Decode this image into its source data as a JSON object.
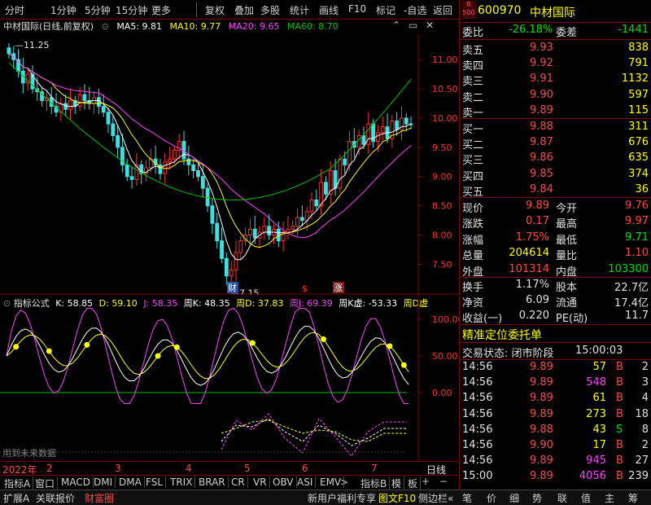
{
  "toolbar": {
    "items": [
      "分时",
      "1分钟",
      "5分钟",
      "15分钟",
      "更多",
      "复权",
      "叠加",
      "多股",
      "统计",
      "画线",
      "F10",
      "标记",
      "-自选",
      "返回"
    ]
  },
  "chart_header": {
    "name": "中材国际(日线,前复权)",
    "ma5": "MA5: 9.81",
    "ma10": "MA10: 9.77",
    "ma20": "MA20: 9.65",
    "ma60": "MA60: 8.70"
  },
  "colors": {
    "ma5": "#ffffff",
    "ma10": "#ffff00",
    "ma20": "#ff40ff",
    "ma60": "#00c000",
    "up": "#ff3030",
    "down": "#40e0e0"
  },
  "price_axis": [
    "11.00",
    "10.50",
    "10.00",
    "9.50",
    "9.00",
    "8.50",
    "8.00",
    "7.50"
  ],
  "annotations": {
    "high": "11.25",
    "low": "7.15",
    "cai": "财",
    "s": "$",
    "zhang": "涨"
  },
  "indicator_header": {
    "title": "指标公式",
    "k": "K: 58.85",
    "d": "D: 59.10",
    "j": "J: 58.35",
    "wk": "周K: 48.35",
    "wd": "周D: 37.83",
    "wj": "周J: 69.39",
    "wkx": "周K虚: -53.33",
    "wdx": "周D虚"
  },
  "indicator_axis": [
    "100.00",
    "50.00",
    "0.00"
  ],
  "future_note": "用到未来数据",
  "date_axis": {
    "year": "2022年",
    "months": [
      "2",
      "3",
      "4",
      "5",
      "6",
      "7"
    ],
    "period": "日线"
  },
  "bottom_tabs": [
    "指标A",
    "窗口",
    "MACD",
    "DMI",
    "DMA",
    "FSL",
    "TRIX",
    "BRAR",
    "CR",
    "VR",
    "OBV",
    "ASI",
    "EMV",
    "指标B",
    "模",
    "板"
  ],
  "status_bar": {
    "items": [
      "扩展A",
      "关联报价",
      "财富圈"
    ],
    "right": [
      "新用户福利专享",
      "图文F10",
      "侧边栏«",
      "笔",
      "价",
      "细",
      "势",
      "联",
      "值",
      "主",
      "筹"
    ]
  },
  "quote": {
    "r_badge": "R",
    "market": "500",
    "code": "600970",
    "name": "中材国际",
    "weibi_label": "委比",
    "weibi": "-26.18%",
    "weicha_label": "委差",
    "weicha": "-1441",
    "asks": [
      {
        "label": "卖五",
        "price": "9.93",
        "vol": "838"
      },
      {
        "label": "卖四",
        "price": "9.92",
        "vol": "791"
      },
      {
        "label": "卖三",
        "price": "9.91",
        "vol": "1132"
      },
      {
        "label": "卖二",
        "price": "9.90",
        "vol": "597"
      },
      {
        "label": "卖一",
        "price": "9.89",
        "vol": "115"
      }
    ],
    "bids": [
      {
        "label": "买一",
        "price": "9.88",
        "vol": "311"
      },
      {
        "label": "买二",
        "price": "9.87",
        "vol": "676"
      },
      {
        "label": "买三",
        "price": "9.86",
        "vol": "635"
      },
      {
        "label": "买四",
        "price": "9.85",
        "vol": "374"
      },
      {
        "label": "买五",
        "price": "9.84",
        "vol": "36"
      }
    ],
    "stats": [
      {
        "l1": "现价",
        "v1": "9.89",
        "c1": "red",
        "l2": "今开",
        "v2": "9.76",
        "c2": "red"
      },
      {
        "l1": "涨跌",
        "v1": "0.17",
        "c1": "red",
        "l2": "最高",
        "v2": "9.97",
        "c2": "red"
      },
      {
        "l1": "涨幅",
        "v1": "1.75%",
        "c1": "red",
        "l2": "最低",
        "v2": "9.71",
        "c2": "grn"
      },
      {
        "l1": "总量",
        "v1": "204614",
        "c1": "yel",
        "l2": "量比",
        "v2": "1.10",
        "c2": "red"
      },
      {
        "l1": "外盘",
        "v1": "101314",
        "c1": "red",
        "l2": "内盘",
        "v2": "103300",
        "c2": "grn"
      }
    ],
    "stats2": [
      {
        "l1": "换手",
        "v1": "1.17%",
        "l2": "股本",
        "v2": "22.7亿"
      },
      {
        "l1": "净资",
        "v1": "6.09",
        "l2": "流通",
        "v2": "17.4亿"
      },
      {
        "l1": "收益(一)",
        "v1": "0.220",
        "l2": "PE(动)",
        "v2": "11.7"
      }
    ],
    "order_title": "精准定位委托单",
    "trade_state_label": "交易状态: 闭市阶段",
    "trade_state_time": "15:00:03",
    "ticks": [
      {
        "t": "14:56",
        "p": "9.89",
        "v": "57",
        "s": "B",
        "n": "2"
      },
      {
        "t": "14:56",
        "p": "9.89",
        "v": "548",
        "s": "B",
        "n": "3"
      },
      {
        "t": "14:56",
        "p": "9.89",
        "v": "61",
        "s": "B",
        "n": "4"
      },
      {
        "t": "14:56",
        "p": "9.89",
        "v": "273",
        "s": "B",
        "n": "18"
      },
      {
        "t": "14:56",
        "p": "9.88",
        "v": "43",
        "s": "S",
        "n": "8"
      },
      {
        "t": "14:56",
        "p": "9.90",
        "v": "17",
        "s": "B",
        "n": "2"
      },
      {
        "t": "14:56",
        "p": "9.89",
        "v": "945",
        "s": "B",
        "n": "27"
      },
      {
        "t": "15:00",
        "p": "9.89",
        "v": "4056",
        "s": "B",
        "n": "239"
      }
    ]
  }
}
